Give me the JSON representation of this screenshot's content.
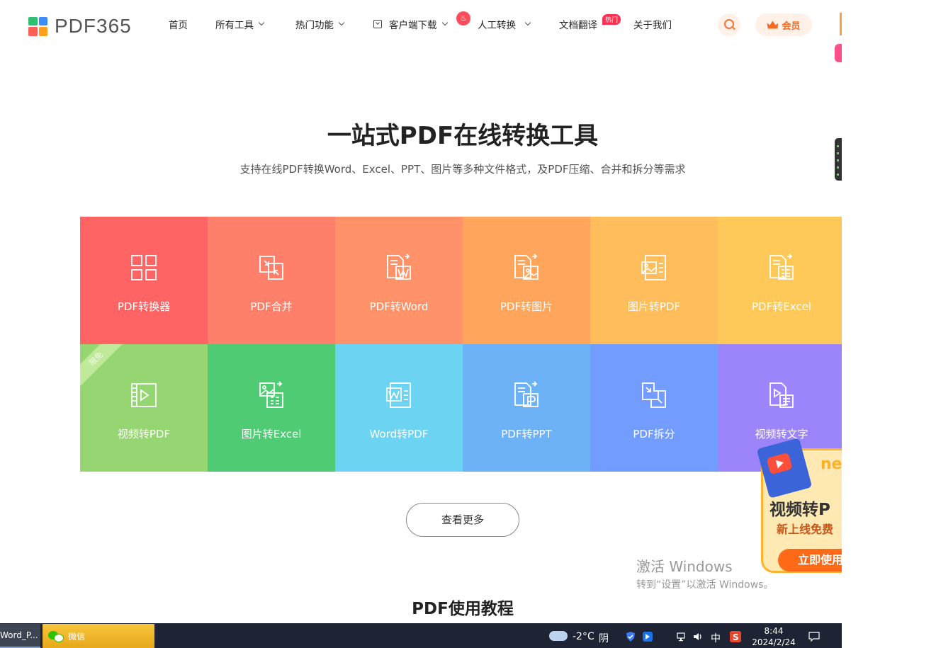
{
  "brand": {
    "logo_text": "PDF365",
    "logo_colors": [
      "#ff5f57",
      "#2fbf71",
      "#ff9f1a",
      "#3f8cff"
    ]
  },
  "nav": {
    "items": [
      {
        "label": "首页"
      },
      {
        "label": "所有工具"
      },
      {
        "label": "热门功能"
      },
      {
        "label": "客户端下载"
      },
      {
        "label": "人工转换"
      },
      {
        "label": "文档翻译"
      },
      {
        "label": "关于我们"
      }
    ],
    "hot_badge": "热门",
    "member_label": "会员"
  },
  "hero": {
    "title": "一站式PDF在线转换工具",
    "subtitle": "支持在线PDF转换Word、Excel、PPT、图片等多种文件格式，及PDF压缩、合并和拆分等需求"
  },
  "tools": [
    {
      "label": "PDF转换器",
      "color": "#ff6464",
      "icon": "grid-icon"
    },
    {
      "label": "PDF合并",
      "color": "#ff806a",
      "icon": "merge-icon"
    },
    {
      "label": "PDF转Word",
      "color": "#ff9268",
      "icon": "word-icon"
    },
    {
      "label": "PDF转图片",
      "color": "#ffa55c",
      "icon": "image-icon"
    },
    {
      "label": "图片转PDF",
      "color": "#ffbd5c",
      "icon": "image-to-pdf-icon"
    },
    {
      "label": "PDF转Excel",
      "color": "#ffc95a",
      "icon": "excel-icon"
    },
    {
      "label": "视频转PDF",
      "color": "#96d672",
      "icon": "video-icon",
      "ribbon": "限免"
    },
    {
      "label": "图片转Excel",
      "color": "#4ecb73",
      "icon": "image-excel-icon"
    },
    {
      "label": "Word转PDF",
      "color": "#6dd3f2",
      "icon": "word-pdf-icon"
    },
    {
      "label": "PDF转PPT",
      "color": "#6db2f7",
      "icon": "ppt-icon"
    },
    {
      "label": "PDF拆分",
      "color": "#739cff",
      "icon": "split-icon"
    },
    {
      "label": "视频转文字",
      "color": "#9c85fb",
      "icon": "video-text-icon"
    }
  ],
  "more_button": "查看更多",
  "section_title": "PDF使用教程",
  "promo": {
    "badge": "ne",
    "title": "视频转P",
    "subtitle": "新上线免费",
    "button": "立即使用"
  },
  "watermark": {
    "line1": "激活 Windows",
    "line2": "转到“设置”以激活 Windows。"
  },
  "taskbar": {
    "word_task": "Word_P...",
    "wechat_task": "微信",
    "weather_temp": "-2°C",
    "weather_desc": "阴",
    "ime": "中",
    "time": "8:44",
    "date": "2024/2/24"
  }
}
